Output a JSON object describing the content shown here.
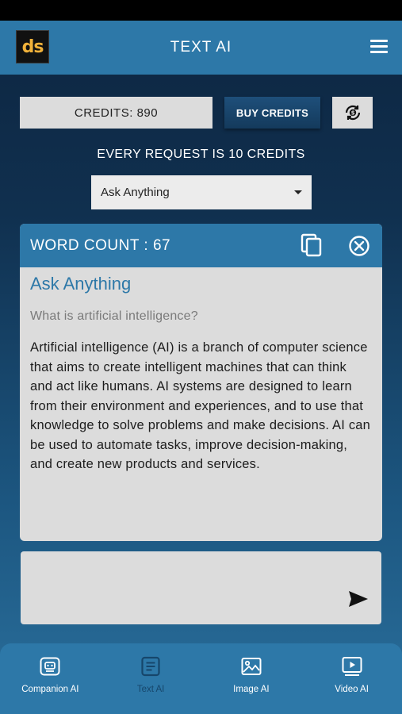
{
  "app": {
    "logo_text": "ds",
    "title": "TEXT AI"
  },
  "credits": {
    "label": "CREDITS: 890",
    "buy_label": "BUY CREDITS",
    "note": "EVERY REQUEST IS 10 CREDITS"
  },
  "mode_select": {
    "selected": "Ask Anything"
  },
  "result": {
    "word_count": "WORD COUNT : 67",
    "title": "Ask Anything",
    "question": "What is artificial intelligence?",
    "answer": "Artificial intelligence (AI) is a branch of computer science that aims to create intelligent machines that can think and act like humans. AI systems are designed to learn from their environment and experiences, and to use that knowledge to solve problems and make decisions. AI can be used to automate tasks, improve decision-making, and create new products and services."
  },
  "prompt_input": {
    "value": ""
  },
  "nav": {
    "items": [
      {
        "label": "Companion AI",
        "icon": "companion-icon",
        "active": false
      },
      {
        "label": "Text AI",
        "icon": "text-doc-icon",
        "active": true
      },
      {
        "label": "Image AI",
        "icon": "image-icon",
        "active": false
      },
      {
        "label": "Video AI",
        "icon": "video-icon",
        "active": false
      }
    ]
  },
  "colors": {
    "primary": "#2d78a8",
    "background_top": "#0d2540",
    "card": "#dcdcdc",
    "logo_accent": "#f0b13a",
    "nav_active": "#16466b"
  }
}
